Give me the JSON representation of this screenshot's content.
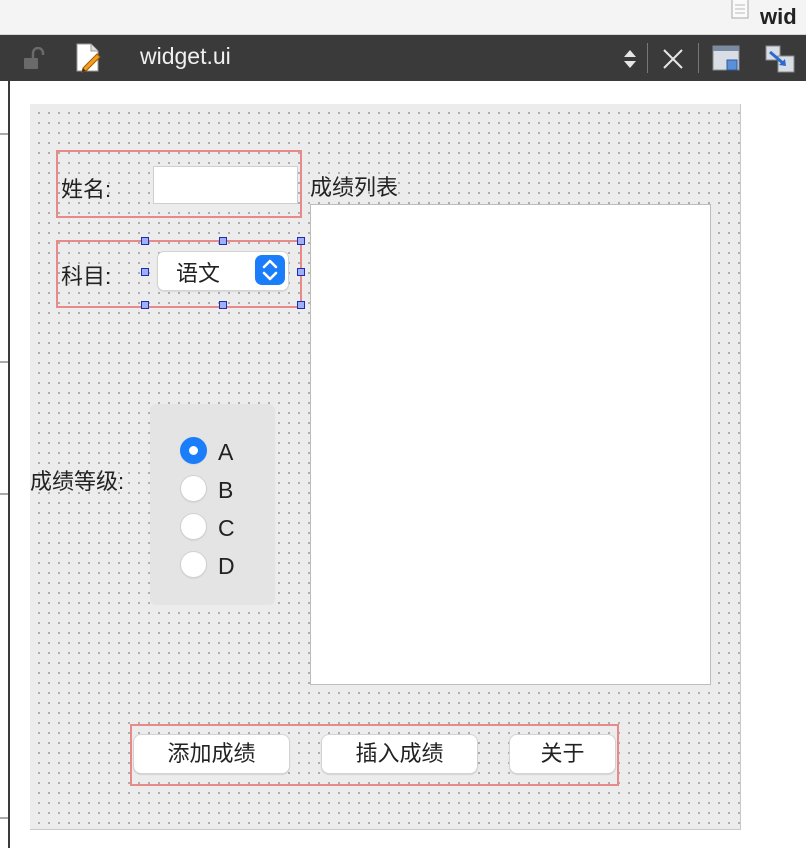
{
  "window": {
    "title_fragment": "wid"
  },
  "editor": {
    "file_name": "widget.ui"
  },
  "form": {
    "name_label": "姓名:",
    "name_value": "",
    "subject_label": "科目:",
    "subject_value": "语文",
    "list_label": "成绩列表",
    "grade_label": "成绩等级:",
    "grades": [
      {
        "label": "A",
        "checked": true
      },
      {
        "label": "B",
        "checked": false
      },
      {
        "label": "C",
        "checked": false
      },
      {
        "label": "D",
        "checked": false
      }
    ],
    "buttons": {
      "add": "添加成绩",
      "insert": "插入成绩",
      "about": "关于"
    }
  },
  "colors": {
    "accent": "#1a7dfa",
    "layout_border": "#e98a8a",
    "header_bg": "#3a3a3a",
    "selection_handle": "#1d2bb5"
  },
  "icons": [
    "document-icon",
    "lock-icon",
    "edit-pencil-icon",
    "sort-arrows-icon",
    "close-icon",
    "layout-icon",
    "signal-slot-icon"
  ]
}
